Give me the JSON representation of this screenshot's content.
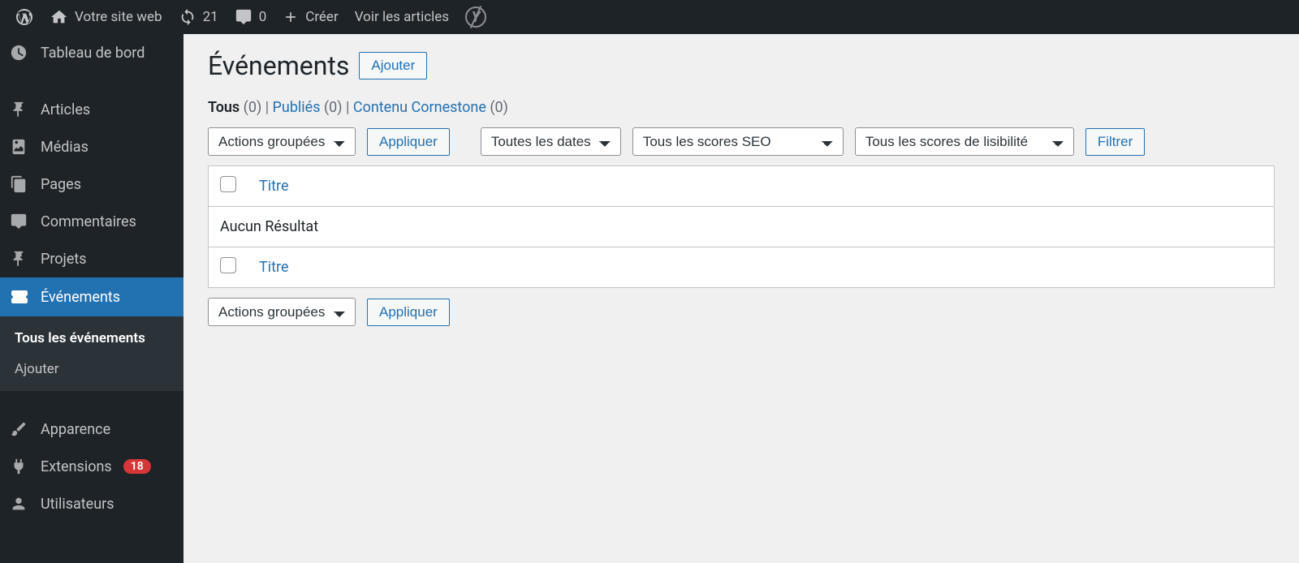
{
  "adminbar": {
    "site_name": "Votre site web",
    "updates_count": "21",
    "comments_count": "0",
    "create_label": "Créer",
    "view_posts_label": "Voir les articles"
  },
  "sidebar": {
    "dashboard": "Tableau de bord",
    "posts": "Articles",
    "media": "Médias",
    "pages": "Pages",
    "comments": "Commentaires",
    "projects": "Projets",
    "events": "Événements",
    "events_sub_all": "Tous les événements",
    "events_sub_add": "Ajouter",
    "appearance": "Apparence",
    "plugins": "Extensions",
    "plugins_badge": "18",
    "users": "Utilisateurs"
  },
  "page": {
    "title": "Événements",
    "add_button": "Ajouter"
  },
  "filters": {
    "all_label": "Tous",
    "all_count": "(0)",
    "published_label": "Publiés",
    "published_count": "(0)",
    "cornerstone_label": "Contenu Cornestone",
    "cornerstone_count": "(0)",
    "separator": "  |  "
  },
  "controls": {
    "bulk_actions": "Actions groupées",
    "apply": "Appliquer",
    "all_dates": "Toutes les dates",
    "seo_scores": "Tous les scores SEO",
    "readability_scores": "Tous les scores de lisibilité",
    "filter": "Filtrer"
  },
  "table": {
    "title_col": "Titre",
    "no_results": "Aucun Résultat"
  }
}
